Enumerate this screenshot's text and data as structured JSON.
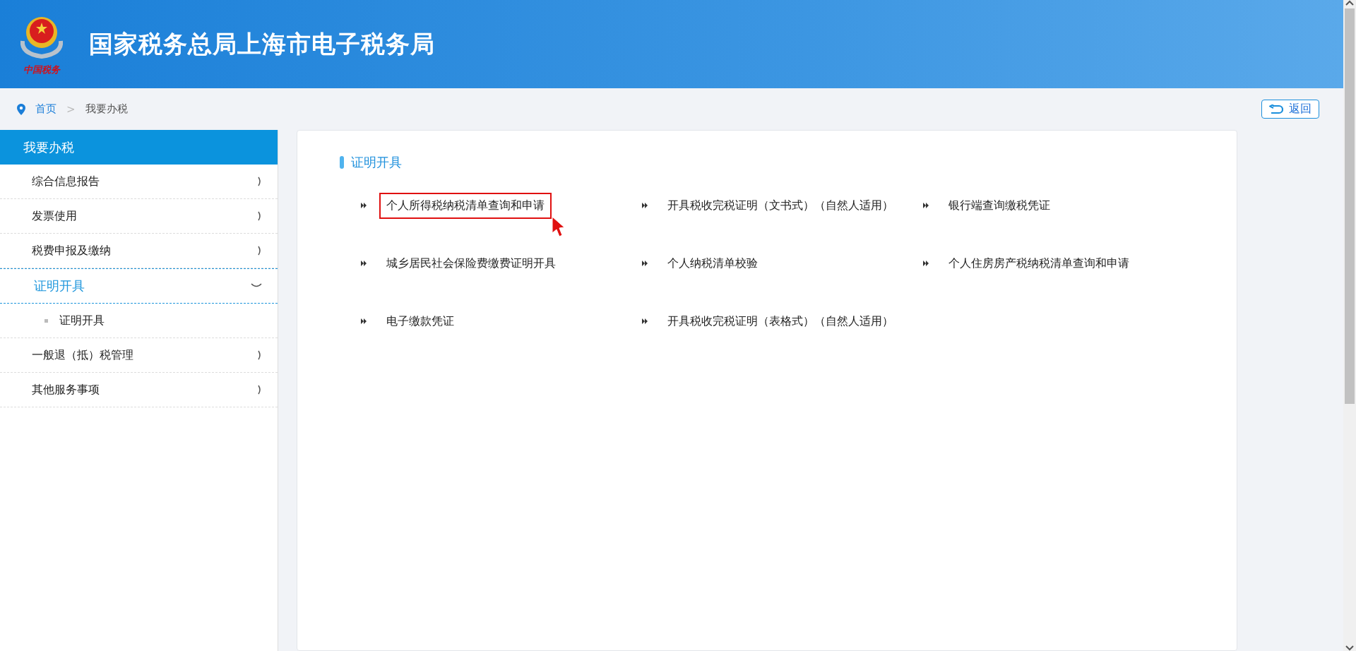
{
  "header": {
    "title": "国家税务总局上海市电子税务局",
    "emblem_caption": "中国税务"
  },
  "breadcrumb": [
    {
      "label": "首页",
      "kind": "link"
    },
    {
      "label": ">",
      "kind": "separator"
    },
    {
      "label": "我要办税",
      "kind": "current"
    }
  ],
  "back_button": {
    "label": "返回"
  },
  "sidebar": {
    "title": "我要办税",
    "items": [
      {
        "label": "综合信息报告",
        "expanded": false
      },
      {
        "label": "发票使用",
        "expanded": false
      },
      {
        "label": "税费申报及缴纳",
        "expanded": false
      },
      {
        "label": "证明开具",
        "expanded": true,
        "children": [
          {
            "label": "证明开具"
          }
        ]
      },
      {
        "label": "一般退（抵）税管理",
        "expanded": false
      },
      {
        "label": "其他服务事项",
        "expanded": false
      }
    ]
  },
  "section": {
    "title": "证明开具",
    "links": [
      {
        "label": "个人所得税纳税清单查询和申请",
        "highlighted": true
      },
      {
        "label": "开具税收完税证明（文书式）（自然人适用）",
        "highlighted": false
      },
      {
        "label": "银行端查询缴税凭证",
        "highlighted": false
      },
      {
        "label": "城乡居民社会保险费缴费证明开具",
        "highlighted": false
      },
      {
        "label": "个人纳税清单校验",
        "highlighted": false
      },
      {
        "label": "个人住房房产税纳税清单查询和申请",
        "highlighted": false
      },
      {
        "label": "电子缴款凭证",
        "highlighted": false
      },
      {
        "label": "开具税收完税证明（表格式）（自然人适用）",
        "highlighted": false
      }
    ]
  }
}
